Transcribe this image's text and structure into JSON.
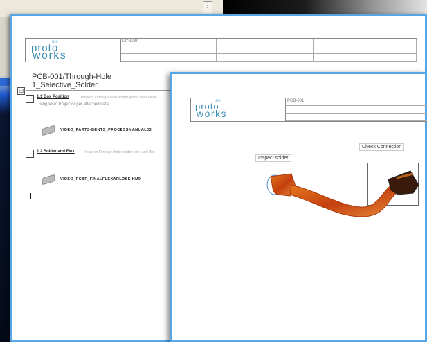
{
  "background": {
    "taskbar_glyph": "⋮"
  },
  "doc_window": {
    "header": {
      "logo_top": "ure",
      "logo_line1": "proto",
      "logo_line2": "works",
      "doc_code": "PCB-001",
      "cells": [
        "",
        "",
        "",
        "",
        "",
        ""
      ]
    },
    "title_line1": "PCB-001/Through-Hole",
    "title_line2": "1_Selective_Solder",
    "expander": "⊞",
    "steps": [
      {
        "title": "1.1 Box Position",
        "desc": "Inspect Through-hole solder joints after wave",
        "sub": "Using Visio Projector per attached data",
        "file": "VIDEO_PARTS-BENTS_PROCESSMANUAL03"
      },
      {
        "title": "1.2 Solder and Flex",
        "desc": "Inspect Through-hole solder joint and flex",
        "file": "VIDEO_PCBF_FINALFLEXARLOSE.HMD"
      }
    ]
  },
  "image_window": {
    "header": {
      "logo_top": "ure",
      "logo_line1": "proto",
      "logo_line2": "works",
      "doc_code": "PCB-001"
    },
    "callouts": {
      "inspect": "Inspect solder",
      "check": "Check Connection"
    }
  },
  "colors": {
    "window_border": "#55a6e6",
    "logo": "#3d8eb4",
    "flex_cable": "#d2581a"
  }
}
